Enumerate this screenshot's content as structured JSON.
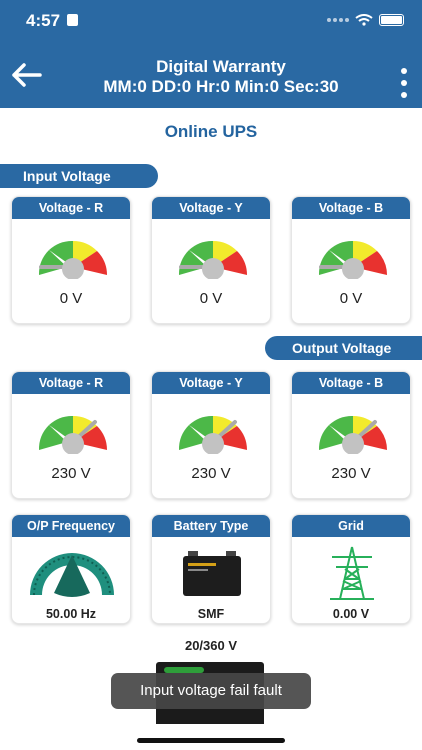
{
  "status_bar": {
    "time": "4:57"
  },
  "header": {
    "title": "Digital Warranty",
    "subtitle": "MM:0 DD:0 Hr:0 Min:0 Sec:30"
  },
  "page_title": "Online UPS",
  "input_voltage": {
    "label": "Input Voltage",
    "cards": [
      {
        "title": "Voltage - R",
        "value": "0 V",
        "level": 0
      },
      {
        "title": "Voltage - Y",
        "value": "0 V",
        "level": 0
      },
      {
        "title": "Voltage - B",
        "value": "0 V",
        "level": 0
      }
    ]
  },
  "output_voltage": {
    "label": "Output Voltage",
    "cards": [
      {
        "title": "Voltage - R",
        "value": "230 V",
        "level": 0.8
      },
      {
        "title": "Voltage - Y",
        "value": "230 V",
        "level": 0.8
      },
      {
        "title": "Voltage - B",
        "value": "230 V",
        "level": 0.8
      }
    ]
  },
  "info_cards": [
    {
      "title": "O/P Frequency",
      "value": "50.00 Hz"
    },
    {
      "title": "Battery Type",
      "value": "SMF"
    },
    {
      "title": "Grid",
      "value": "0.00 V"
    }
  ],
  "battery_label": "20/360 V",
  "toast": "Input voltage fail fault",
  "colors": {
    "primary": "#2a69a3",
    "gauge_green": "#4cb848",
    "gauge_yellow": "#f2ea2c",
    "gauge_red": "#e8322f",
    "teal": "#1f8f7e"
  }
}
